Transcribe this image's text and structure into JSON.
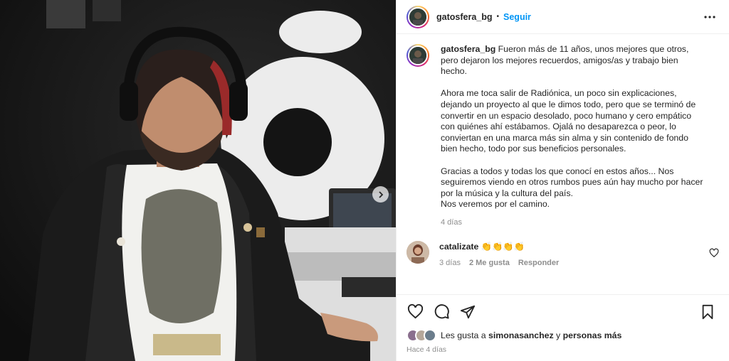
{
  "post": {
    "username": "gatosfera_bg",
    "separator": "•",
    "follow_label": "Seguir",
    "more_icon": "more-horizontal-icon"
  },
  "caption": {
    "username": "gatosfera_bg",
    "paragraph1": "Fueron más de 11 años, unos mejores que otros, pero dejaron los mejores recuerdos, amigos/as y trabajo bien hecho.",
    "paragraph2": "Ahora me toca salir de Radiónica, un poco sin explicaciones, dejando un proyecto al que le dimos todo, pero que se terminó de convertir en un espacio desolado, poco humano y cero empático con quiénes ahí estábamos. Ojalá no desaparezca o peor, lo conviertan en una marca más sin alma y sin contenido de fondo bien hecho, todo por sus beneficios personales.",
    "paragraph3": "Gracias a todos y todas los que conocí en estos años... Nos seguiremos viendo en otros rumbos pues aún hay mucho por hacer por la música y la cultura del país.",
    "paragraph4": "Nos veremos por el camino.",
    "time": "4 días"
  },
  "comment": {
    "username": "catalizate",
    "text": "👏👏👏👏",
    "time": "3 días",
    "likes": "2 Me gusta",
    "reply_label": "Responder"
  },
  "likes": {
    "prefix": "Les gusta a",
    "user": "simonasanchez",
    "connector": "y",
    "others": "personas más"
  },
  "posted_ago": "Hace 4 días",
  "colors": {
    "link_blue": "#0095f6",
    "meta_gray": "#8e8e8e",
    "border": "#efefef"
  }
}
